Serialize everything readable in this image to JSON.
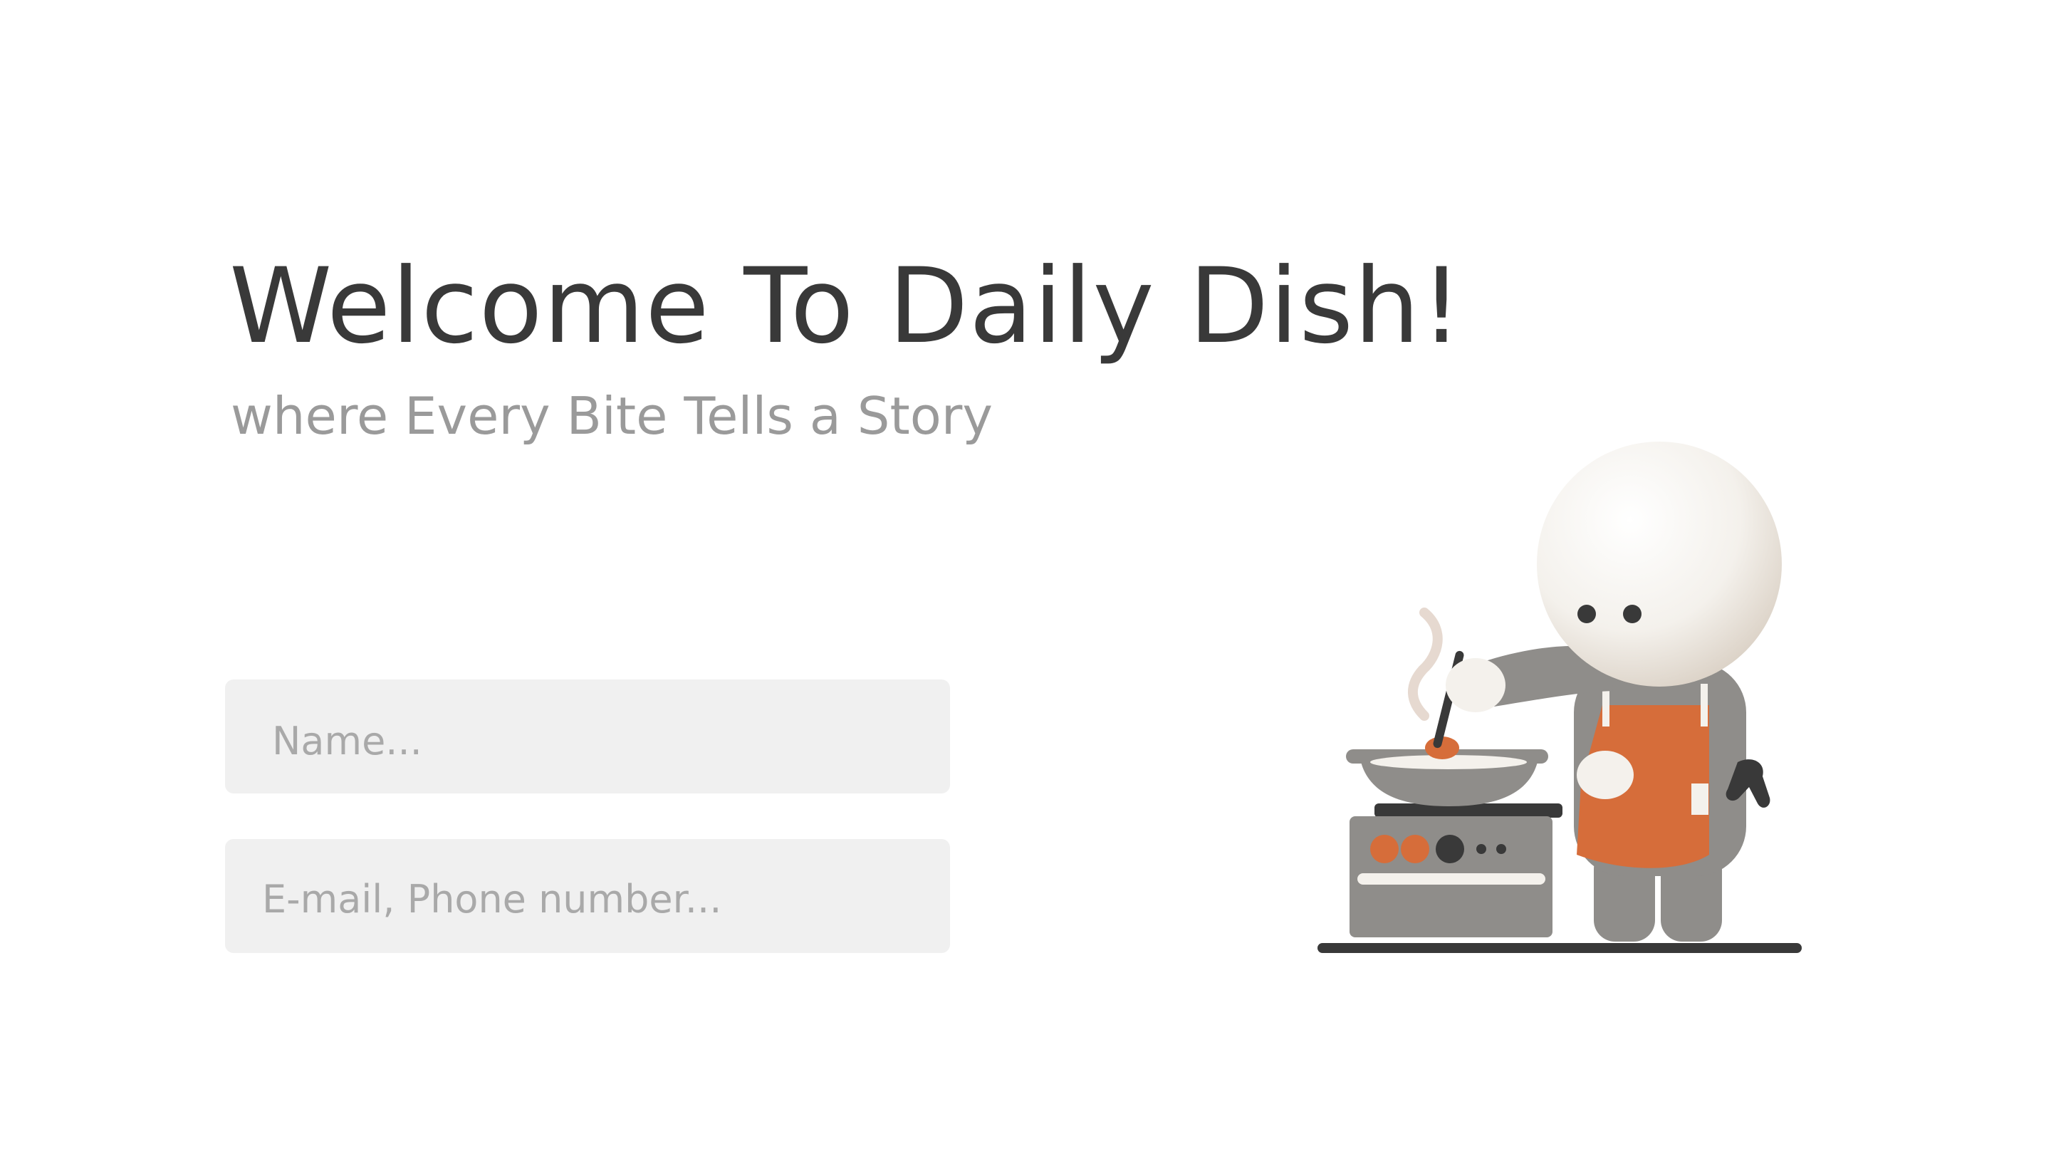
{
  "hero": {
    "title": "Welcome To Daily Dish!",
    "subtitle": "where Every Bite Tells a Story"
  },
  "form": {
    "name_placeholder": "Name...",
    "contact_placeholder": "E-mail, Phone number..."
  },
  "illustration": {
    "subject": "chef-cooking-at-stove",
    "colors": {
      "head": "#f4f1ec",
      "body": "#8f8d8a",
      "apron": "#d66d3a",
      "stove": "#8f8d8a",
      "knob_orange": "#d66d3a",
      "knob_dark": "#393939",
      "floor": "#393939",
      "steam": "#e6d9d0"
    }
  },
  "theme": {
    "text_dark": "#393939",
    "text_muted": "#9a9a9a",
    "input_bg": "#f0f0f0",
    "placeholder": "#a9a9a9"
  }
}
